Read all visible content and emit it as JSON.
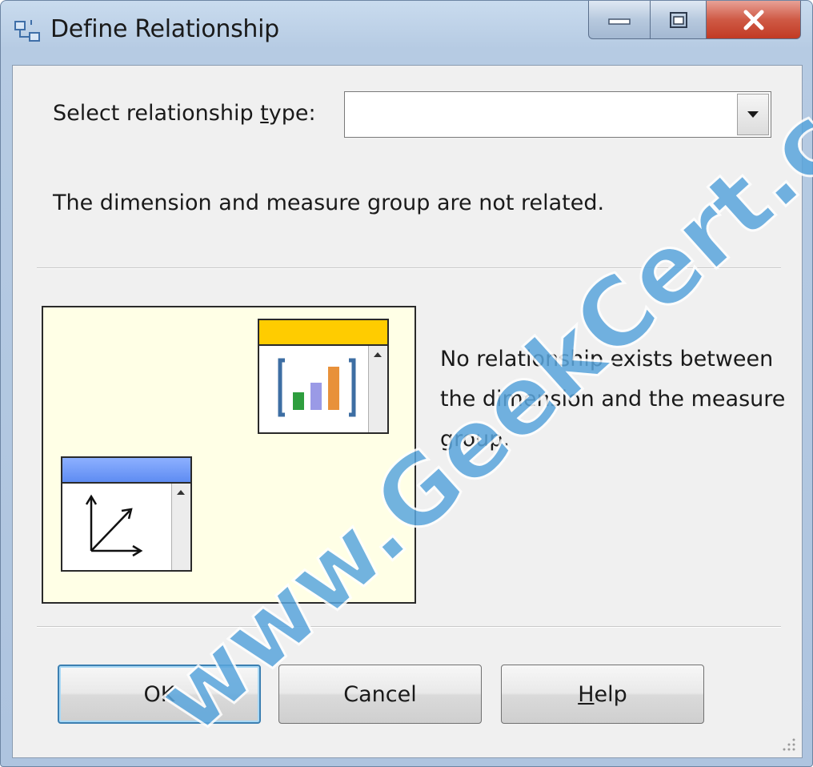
{
  "window": {
    "title": "Define Relationship",
    "icon": "relationship-icon"
  },
  "form": {
    "relationship_type_label_pre": "Select relationship ",
    "relationship_type_label_accel": "t",
    "relationship_type_label_post": "ype:",
    "relationship_type_value": "",
    "status": "The dimension and measure group are not related.",
    "description": "No relationship exists between the dimension and the measure group."
  },
  "buttons": {
    "ok": "OK",
    "cancel": "Cancel",
    "help_accel": "H",
    "help_rest": "elp"
  },
  "watermark": "www.GeekCert.com",
  "colors": {
    "diagram_background": "#ffffe6",
    "measure_group_titlebar": "#ffcc00",
    "dimension_titlebar": "#6699ff",
    "ok_focus_border": "#3c7fb1",
    "watermark": "#5aa6dd"
  }
}
